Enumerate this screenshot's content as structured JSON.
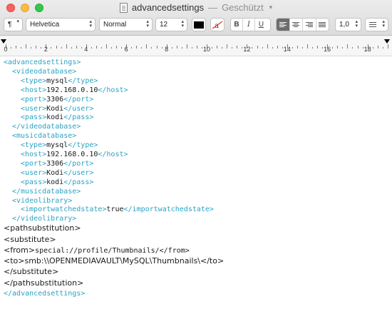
{
  "window": {
    "title": "advancedsettings",
    "title_separator": "—",
    "title_status": "Geschützt"
  },
  "toolbar": {
    "paragraph_label": "¶",
    "font_family": "Helvetica",
    "font_style": "Normal",
    "font_size": "12",
    "bold_label": "B",
    "italic_label": "I",
    "underline_label": "U",
    "line_spacing": "1,0",
    "text_color": "#000000"
  },
  "ruler": {
    "numbers": [
      "0",
      "2",
      "4",
      "6",
      "8",
      "10",
      "12",
      "14",
      "16",
      "18"
    ]
  },
  "document": {
    "lines": [
      {
        "style": "mono",
        "indent": 0,
        "parts": [
          {
            "t": "<advancedsettings>",
            "c": "tag"
          }
        ]
      },
      {
        "style": "mono",
        "indent": 1,
        "parts": [
          {
            "t": "<videodatabase>",
            "c": "tag"
          }
        ]
      },
      {
        "style": "mono",
        "indent": 2,
        "parts": [
          {
            "t": "<type>",
            "c": "tag"
          },
          {
            "t": "mysql",
            "c": "val"
          },
          {
            "t": "</type>",
            "c": "tag"
          }
        ]
      },
      {
        "style": "mono",
        "indent": 2,
        "parts": [
          {
            "t": "<host>",
            "c": "tag"
          },
          {
            "t": "192.168.0.10",
            "c": "val"
          },
          {
            "t": "</host>",
            "c": "tag"
          }
        ]
      },
      {
        "style": "mono",
        "indent": 2,
        "parts": [
          {
            "t": "<port>",
            "c": "tag"
          },
          {
            "t": "3306",
            "c": "val"
          },
          {
            "t": "</port>",
            "c": "tag"
          }
        ]
      },
      {
        "style": "mono",
        "indent": 2,
        "parts": [
          {
            "t": "<user>",
            "c": "tag"
          },
          {
            "t": "Kodi",
            "c": "val"
          },
          {
            "t": "</user>",
            "c": "tag"
          }
        ]
      },
      {
        "style": "mono",
        "indent": 2,
        "parts": [
          {
            "t": "<pass>",
            "c": "tag"
          },
          {
            "t": "kodi",
            "c": "val"
          },
          {
            "t": "</pass>",
            "c": "tag"
          }
        ]
      },
      {
        "style": "mono",
        "indent": 1,
        "parts": [
          {
            "t": "</videodatabase>",
            "c": "tag"
          }
        ]
      },
      {
        "style": "mono",
        "indent": 1,
        "parts": [
          {
            "t": "<musicdatabase>",
            "c": "tag"
          }
        ]
      },
      {
        "style": "mono",
        "indent": 2,
        "parts": [
          {
            "t": "<type>",
            "c": "tag"
          },
          {
            "t": "mysql",
            "c": "val"
          },
          {
            "t": "</type>",
            "c": "tag"
          }
        ]
      },
      {
        "style": "mono",
        "indent": 2,
        "parts": [
          {
            "t": "<host>",
            "c": "tag"
          },
          {
            "t": "192.168.0.10",
            "c": "val"
          },
          {
            "t": "</host>",
            "c": "tag"
          }
        ]
      },
      {
        "style": "mono",
        "indent": 2,
        "parts": [
          {
            "t": "<port>",
            "c": "tag"
          },
          {
            "t": "3306",
            "c": "val"
          },
          {
            "t": "</port>",
            "c": "tag"
          }
        ]
      },
      {
        "style": "mono",
        "indent": 2,
        "parts": [
          {
            "t": "<user>",
            "c": "tag"
          },
          {
            "t": "Kodi",
            "c": "val"
          },
          {
            "t": "</user>",
            "c": "tag"
          }
        ]
      },
      {
        "style": "mono",
        "indent": 2,
        "parts": [
          {
            "t": "<pass>",
            "c": "tag"
          },
          {
            "t": "kodi",
            "c": "val"
          },
          {
            "t": "</pass>",
            "c": "tag"
          }
        ]
      },
      {
        "style": "mono",
        "indent": 1,
        "parts": [
          {
            "t": "</musicdatabase>",
            "c": "tag"
          }
        ]
      },
      {
        "style": "mono",
        "indent": 1,
        "parts": [
          {
            "t": "<videolibrary>",
            "c": "tag"
          }
        ]
      },
      {
        "style": "mono",
        "indent": 2,
        "parts": [
          {
            "t": "<importwatchedstate>",
            "c": "tag"
          },
          {
            "t": "true",
            "c": "val"
          },
          {
            "t": "</importwatchedstate>",
            "c": "tag"
          }
        ]
      },
      {
        "style": "mono",
        "indent": 1,
        "parts": [
          {
            "t": "</videolibrary>",
            "c": "tag"
          }
        ]
      },
      {
        "style": "sans",
        "indent": 0,
        "parts": [
          {
            "t": "<pathsubstitution>",
            "c": "val"
          }
        ]
      },
      {
        "style": "sans",
        "indent": 0,
        "parts": [
          {
            "t": "<substitute>",
            "c": "val"
          }
        ]
      },
      {
        "style": "sans",
        "indent": 0,
        "parts": [
          {
            "t": "<from>",
            "c": "val"
          },
          {
            "t": "special://profile/Thumbnails/</from>",
            "c": "val",
            "mono": true
          }
        ]
      },
      {
        "style": "sans",
        "indent": 0,
        "parts": [
          {
            "t": "<to>smb:\\\\OPENMEDIAVAULT\\MySQL\\Thumbnails\\</to>",
            "c": "val"
          }
        ]
      },
      {
        "style": "sans",
        "indent": 0,
        "parts": [
          {
            "t": "</substitute>",
            "c": "val"
          }
        ]
      },
      {
        "style": "sans",
        "indent": 0,
        "parts": [
          {
            "t": "</pathsubstitution>",
            "c": "val"
          }
        ]
      },
      {
        "style": "mono",
        "indent": 0,
        "parts": [
          {
            "t": "</advancedsettings>",
            "c": "tag"
          }
        ]
      }
    ]
  }
}
